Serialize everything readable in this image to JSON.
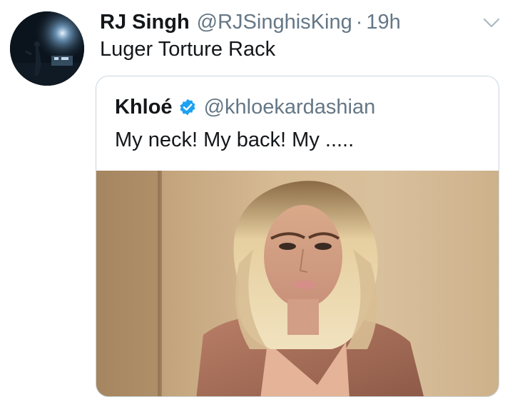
{
  "tweet": {
    "display_name": "RJ Singh",
    "handle": "@RJSinghisKing",
    "separator": "·",
    "time": "19h",
    "text": "Luger Torture Rack",
    "avatar_icon": "concert-avatar",
    "menu_icon": "chevron-down-icon"
  },
  "quoted": {
    "display_name": "Khloé",
    "verified_icon": "verified-badge-icon",
    "handle": "@khloekardashian",
    "text": "My neck! My back! My .....",
    "media_icon": "photo-woman-blonde-bob"
  },
  "colors": {
    "text_primary": "#14171a",
    "text_secondary": "#657786",
    "border": "#ccd6dd",
    "verified_blue": "#1da1f2",
    "chevron": "#aab8c2"
  }
}
